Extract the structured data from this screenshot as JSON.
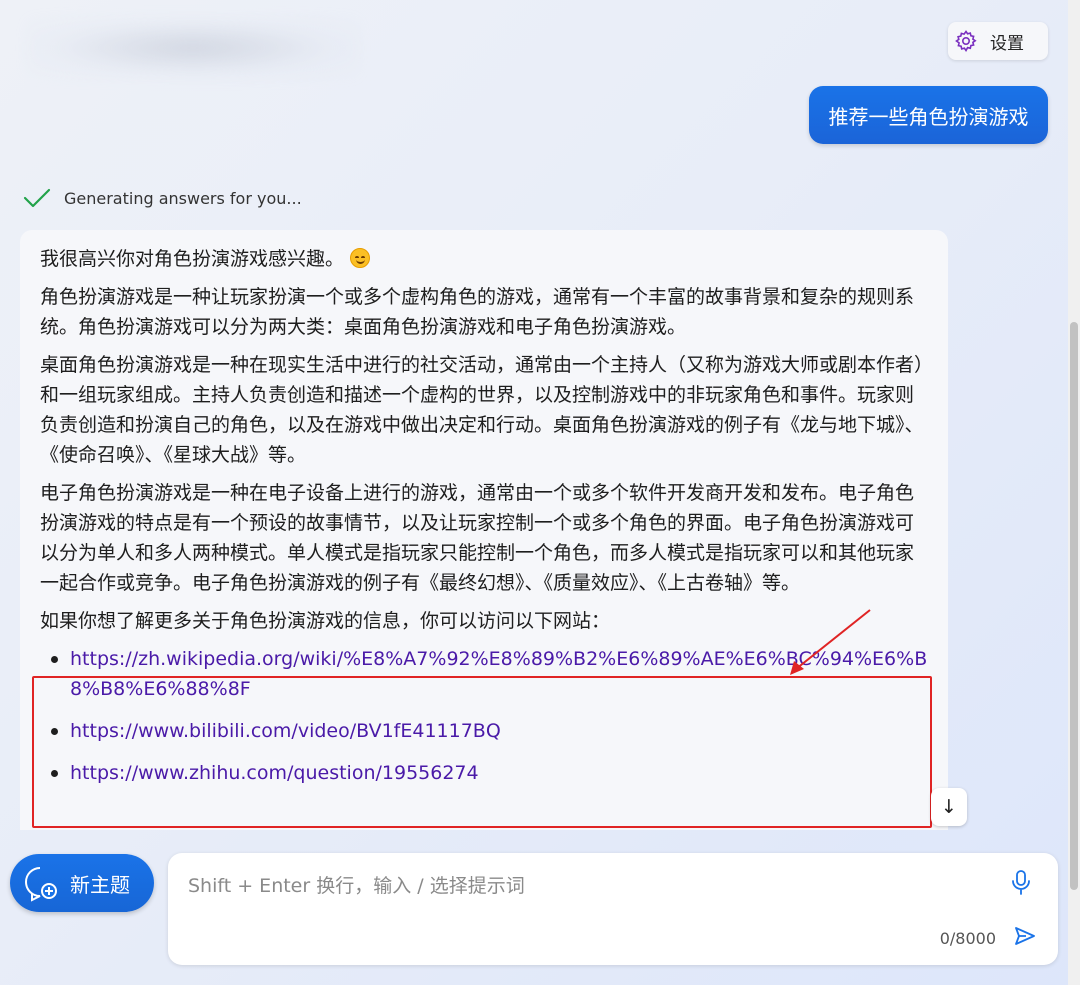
{
  "header": {
    "settings_label": "设置",
    "settings_icon": "gear-icon"
  },
  "user_message": "推荐一些角色扮演游戏",
  "status": {
    "text": "Generating answers for you...",
    "icon": "checkmark-icon",
    "icon_color": "#22a34a"
  },
  "answer": {
    "greeting": "我很高兴你对角色扮演游戏感兴趣。",
    "greeting_emoji": "smiling-face-icon",
    "para1": "角色扮演游戏是一种让玩家扮演一个或多个虚构角色的游戏，通常有一个丰富的故事背景和复杂的规则系统。角色扮演游戏可以分为两大类：桌面角色扮演游戏和电子角色扮演游戏。",
    "para2": "桌面角色扮演游戏是一种在现实生活中进行的社交活动，通常由一个主持人（又称为游戏大师或剧本作者）和一组玩家组成。主持人负责创造和描述一个虚构的世界，以及控制游戏中的非玩家角色和事件。玩家则负责创造和扮演自己的角色，以及在游戏中做出决定和行动。桌面角色扮演游戏的例子有《龙与地下城》、《使命召唤》、《星球大战》等。",
    "para3": "电子角色扮演游戏是一种在电子设备上进行的游戏，通常由一个或多个软件开发商开发和发布。电子角色扮演游戏的特点是有一个预设的故事情节，以及让玩家控制一个或多个角色的界面。电子角色扮演游戏可以分为单人和多人两种模式。单人模式是指玩家只能控制一个角色，而多人模式是指玩家可以和其他玩家一起合作或竞争。电子角色扮演游戏的例子有《最终幻想》、《质量效应》、《上古卷轴》等。",
    "para4": "如果你想了解更多关于角色扮演游戏的信息，你可以访问以下网站：",
    "links": [
      "https://zh.wikipedia.org/wiki/%E8%A7%92%E8%89%B2%E6%89%AE%E6%BC%94%E6%B8%B8%E6%88%8F",
      "https://www.bilibili.com/video/BV1fE41117BQ",
      "https://www.zhihu.com/question/19556274"
    ],
    "link_color": "#4a1aa8"
  },
  "annotation": {
    "box_color": "#e02424"
  },
  "scroll_down_icon": "arrow-down-icon",
  "new_topic": {
    "label": "新主题",
    "icon": "new-chat-icon"
  },
  "composer": {
    "placeholder": "Shift + Enter 换行，输入 / 选择提示词",
    "value": "",
    "counter": "0/8000",
    "mic_icon": "microphone-icon",
    "send_icon": "send-icon"
  },
  "colors": {
    "accent": "#1a73e8"
  }
}
